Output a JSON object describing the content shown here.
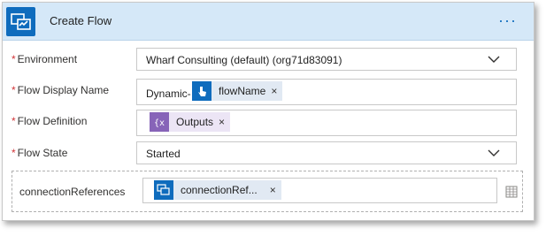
{
  "header": {
    "title": "Create Flow",
    "more_icon": "ellipsis-icon",
    "more_label": "···",
    "logo_icon": "power-automate-logo-icon",
    "accent": "#0f6cbd"
  },
  "fields": {
    "environment": {
      "required_mark": "*",
      "label": "Environment",
      "value": "Wharf Consulting (default) (org71d83091)",
      "icon": "chevron-down-icon"
    },
    "display_name": {
      "required_mark": "*",
      "label": "Flow Display Name",
      "prefix": "Dynamic-",
      "token_label": "flowName",
      "token_remove": "×",
      "token_icon": "touch-trigger-icon",
      "token_color": "#0f6cbd"
    },
    "definition": {
      "required_mark": "*",
      "label": "Flow Definition",
      "token_label": "Outputs",
      "token_remove": "×",
      "token_icon": "expression-icon",
      "token_color": "#8764b8"
    },
    "state": {
      "required_mark": "*",
      "label": "Flow State",
      "value": "Started",
      "icon": "chevron-down-icon"
    },
    "connection_refs": {
      "label": "connectionReferences",
      "token_label": "connectionRef...",
      "token_remove": "×",
      "token_icon": "power-automate-token-icon",
      "token_color": "#0f6cbd",
      "side_icon": "array-switch-icon"
    }
  }
}
